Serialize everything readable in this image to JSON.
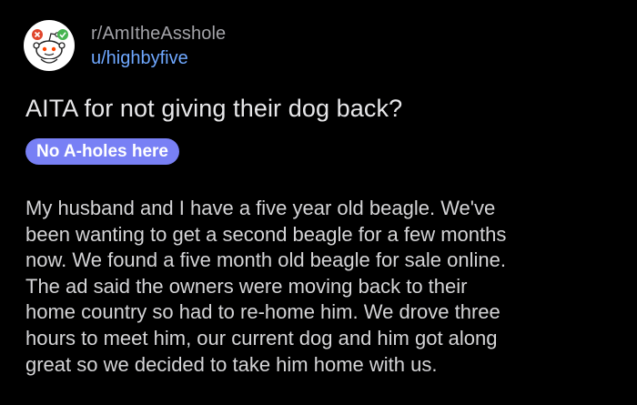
{
  "post": {
    "subreddit": "r/AmItheAsshole",
    "author": "u/highbyfive",
    "title": "AITA for not giving their dog back?",
    "flair": "No A-holes here",
    "body": "My husband and I have a five year old beagle. We've\nbeen wanting to get a second beagle for a few months\nnow. We found a five month old beagle for sale online.\nThe ad said the owners were moving back to their\nhome country so had to re-home him. We drove three\nhours to meet him, our current dog and him got along\ngreat so we decided to take him home with us."
  },
  "icons": {
    "avatar": "subreddit-snoo-icon"
  },
  "colors": {
    "background": "#000000",
    "username": "#6fa8ff",
    "flair_bg": "#7880f5"
  }
}
